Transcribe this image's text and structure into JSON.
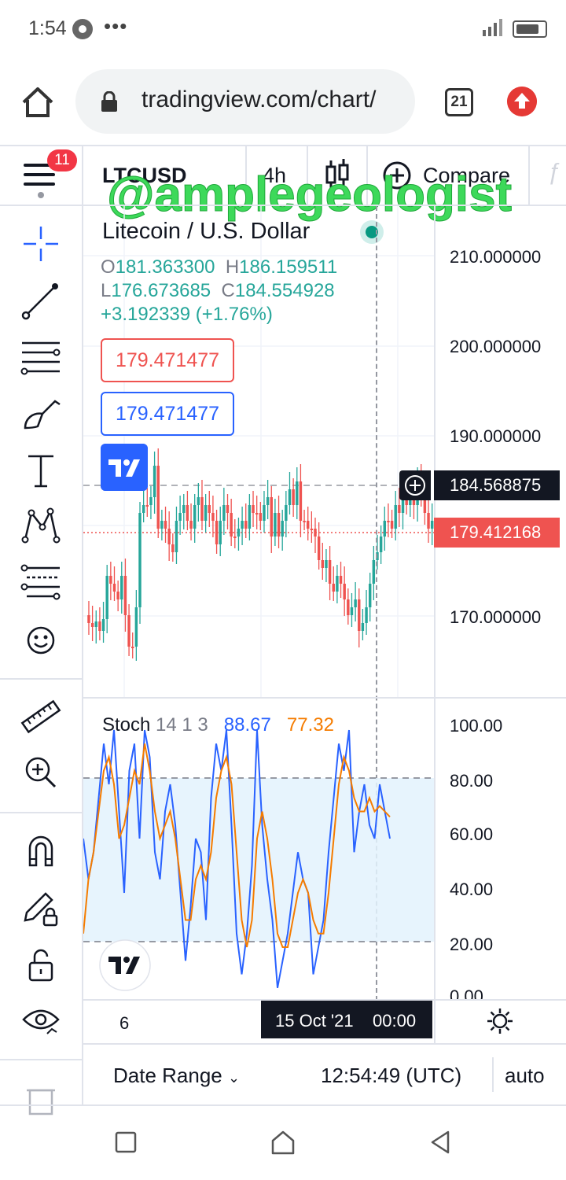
{
  "status_bar": {
    "time": "1:54",
    "dots": "•••"
  },
  "browser": {
    "url": "tradingview.com/chart/",
    "tab_count": "21"
  },
  "toolbar": {
    "badge": "11",
    "symbol": "LTCUSD",
    "interval": "4h",
    "compare_label": "Compare",
    "watermark": "@amplegeologist"
  },
  "chart": {
    "pair_name": "Litecoin / U.S. Dollar",
    "ohlc": {
      "o_label": "O",
      "o": "181.363300",
      "h_label": "H",
      "h": "186.159511",
      "l_label": "L",
      "l": "176.673685",
      "c_label": "C",
      "c": "184.554928",
      "change": "+3.192339 (+1.76%)"
    },
    "sell_price": "179.471477",
    "buy_price": "179.471477",
    "price_axis": [
      "210.000000",
      "200.000000",
      "190.000000",
      "170.000000"
    ],
    "crosshair_price": "184.568875",
    "last_price": "179.412168",
    "colors": {
      "up": "#26a69a",
      "down": "#ef5350",
      "accent": "#2962ff",
      "stoch_k": "#2962ff",
      "stoch_d": "#f57c00"
    }
  },
  "stoch": {
    "title": "Stoch",
    "params": "14 1 3",
    "k_value": "88.67",
    "d_value": "77.32",
    "axis": [
      "100.00",
      "80.00",
      "60.00",
      "40.00",
      "20.00",
      "0.00"
    ]
  },
  "time_axis": {
    "left_label": "6",
    "crosshair_date": "15 Oct '21",
    "crosshair_time": "00:00"
  },
  "bottom_bar": {
    "date_range": "Date Range",
    "clock": "12:54:49 (UTC)",
    "scale": "auto"
  }
}
